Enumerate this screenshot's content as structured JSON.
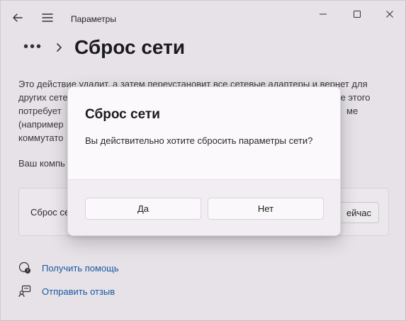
{
  "window": {
    "title": "Параметры"
  },
  "header": {
    "breadcrumb_dots": "•••",
    "page_title": "Сброс сети"
  },
  "description": {
    "lines": [
      "Это действие удалит, а затем переустановит все сетевые адаптеры и вернет для",
      "других сете",
      "потребует",
      "(например",
      "коммутато"
    ],
    "line2_tail": "ле этого",
    "line3_tail": "ме"
  },
  "computer_note": "Ваш компь",
  "reset_card": {
    "label": "Сброс се",
    "button_label": "ейчас"
  },
  "links": {
    "help": "Получить помощь",
    "feedback": "Отправить отзыв"
  },
  "dialog": {
    "title": "Сброс сети",
    "message": "Вы действительно хотите сбросить параметры сети?",
    "yes_label": "Да",
    "no_label": "Нет"
  },
  "colors": {
    "background": "#f3eef4",
    "link": "#1a5ea8",
    "dialog_bg": "#fbf9fc"
  }
}
